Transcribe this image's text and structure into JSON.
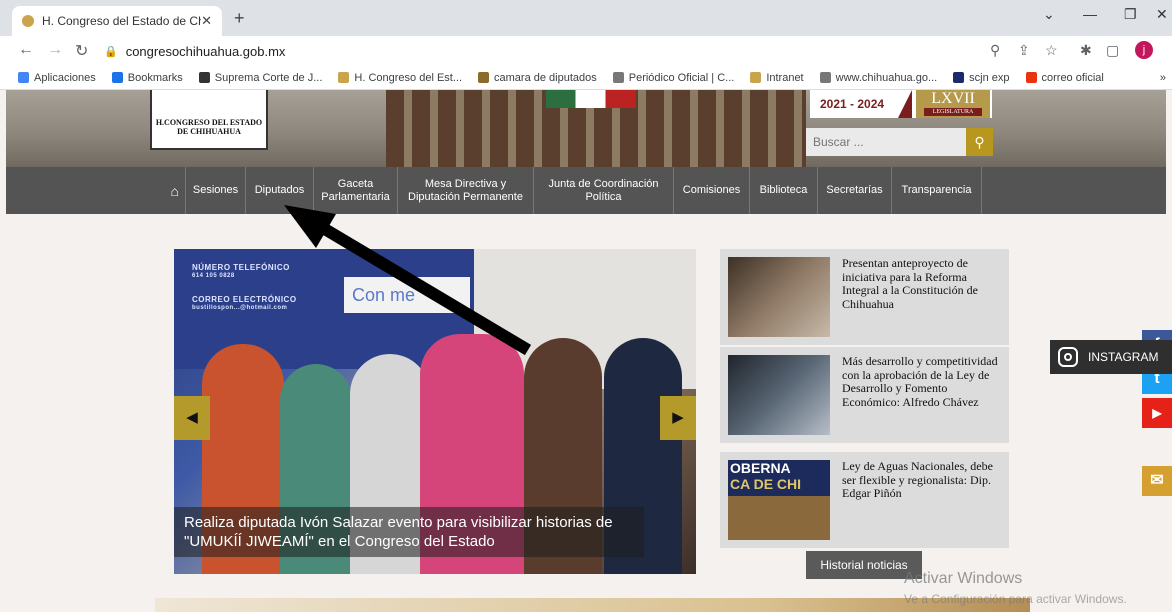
{
  "browser": {
    "tab_title": "H. Congreso del Estado de Chihu",
    "tab_close": "✕",
    "new_tab": "+",
    "url": "congresochihuahua.gob.mx",
    "profile_initial": "j",
    "window_controls": [
      "⌄",
      "—",
      "❐",
      "✕"
    ]
  },
  "bookmarks": [
    {
      "label": "Aplicaciones",
      "icon": "apps-grid-icon",
      "color": "#4285f4"
    },
    {
      "label": "Bookmarks",
      "icon": "star-icon",
      "color": "#1a73e8"
    },
    {
      "label": "Suprema Corte de J...",
      "icon": "globe-icon",
      "color": "#333333"
    },
    {
      "label": "H. Congreso del Est...",
      "icon": "congreso-icon",
      "color": "#c9a44a"
    },
    {
      "label": "camara de diputados",
      "icon": "camara-icon",
      "color": "#8a6d2b"
    },
    {
      "label": "Periódico Oficial | C...",
      "icon": "shield-icon",
      "color": "#777777"
    },
    {
      "label": "Intranet",
      "icon": "congreso-icon",
      "color": "#c9a44a"
    },
    {
      "label": "www.chihuahua.go...",
      "icon": "shield-icon",
      "color": "#777777"
    },
    {
      "label": "scjn exp",
      "icon": "scjn-icon",
      "color": "#1a2a6c"
    },
    {
      "label": "correo oficial",
      "icon": "x-icon",
      "color": "#e8340f"
    }
  ],
  "bookmarks_overflow": "»",
  "header": {
    "logo_text": [
      "H.CONGRESO DEL ESTADO",
      "DE CHIHUAHUA"
    ],
    "years": "2021 - 2024",
    "legislature": "LXVII",
    "legislature_sub": "LEGISLATURA",
    "search_placeholder": "Buscar ..."
  },
  "nav": [
    {
      "label": "Sesiones",
      "w": 60
    },
    {
      "label": "Diputados",
      "w": 68
    },
    {
      "label": "Gaceta\nParlamentaria",
      "w": 84
    },
    {
      "label": "Mesa Directiva y\nDiputación Permanente",
      "w": 136
    },
    {
      "label": "Junta de Coordinación\nPolítica",
      "w": 140
    },
    {
      "label": "Comisiones",
      "w": 76
    },
    {
      "label": "Biblioteca",
      "w": 68
    },
    {
      "label": "Secretarías",
      "w": 74
    },
    {
      "label": "Transparencia",
      "w": 90
    }
  ],
  "slider": {
    "banner_lines": [
      "NÚMERO TELEFÓNICO",
      "614 105 0828",
      "CORREO ELECTRÓNICO",
      "bustillospon...@hotmail.com"
    ],
    "card_text": "Con   me",
    "caption": "Realiza diputada Ivón Salazar evento para visibilizar historias de \"UMUKÍÍ JIWEAMÍ\" en el Congreso del Estado",
    "prev": "◀",
    "next": "▶"
  },
  "news": [
    {
      "title": "Presentan anteproyecto de iniciativa para la Reforma Integral a la Constitución de Chihuahua"
    },
    {
      "title": "Más desarrollo y competitividad con la aprobación de la Ley de Desarrollo y Fomento Económico: Alfredo Chávez"
    },
    {
      "title": "Ley de Aguas Nacionales, debe ser flexible y regionalista: Dip. Edgar Piñón"
    }
  ],
  "news_thumb3_text": [
    "OBERNA",
    "CA DE CHI"
  ],
  "historial_label": "Historial noticias",
  "social": {
    "facebook": "f",
    "twitter": "t",
    "youtube": "▶",
    "instagram_label": "INSTAGRAM",
    "mail": "✉"
  },
  "watermark": {
    "line1": "Activar Windows",
    "line2": "Ve a Configuración para activar Windows."
  },
  "colors": {
    "nav_bg": "#545454",
    "gold": "#b8971f",
    "guinda": "#7a1d1d"
  }
}
